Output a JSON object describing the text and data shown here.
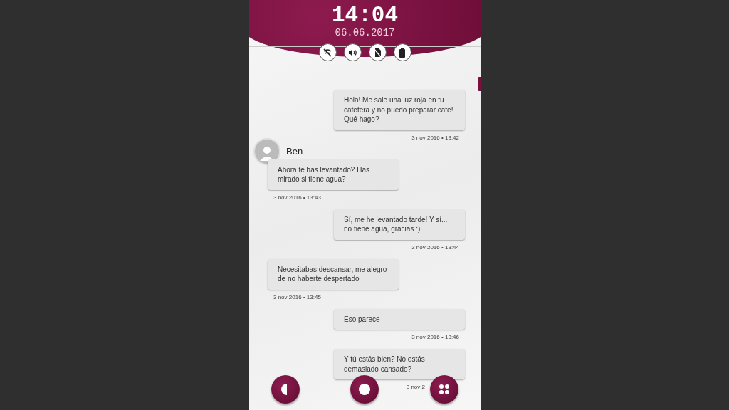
{
  "status": {
    "time": "14:04",
    "date": "06.06.2017"
  },
  "messages": [
    {
      "kind": "outgoing",
      "text": "Hola! Me sale una luz roja en tu cafetera y no puedo preparar café! Qué hago?",
      "timestamp": "3 nov 2016 • 13:42"
    },
    {
      "kind": "incoming",
      "sender": "Ben",
      "text": "Ahora te has levantado? Has mirado si tiene agua?",
      "timestamp": "3 nov 2016 • 13:43"
    },
    {
      "kind": "outgoing",
      "text": "Sí, me he levantado tarde! Y sí... no tiene agua, gracias :)",
      "timestamp": "3 nov 2016 • 13:44"
    },
    {
      "kind": "incoming",
      "text": "Necesitabas descansar, me alegro de no haberte despertado",
      "timestamp": "3 nov 2016 • 13:45"
    },
    {
      "kind": "outgoing",
      "text": "Eso parece",
      "timestamp": "3 nov 2016 • 13:46"
    },
    {
      "kind": "outgoing",
      "text": "Y tú estás bien? No estás demasiado cansado?",
      "timestamp": "3 nov 2"
    }
  ]
}
